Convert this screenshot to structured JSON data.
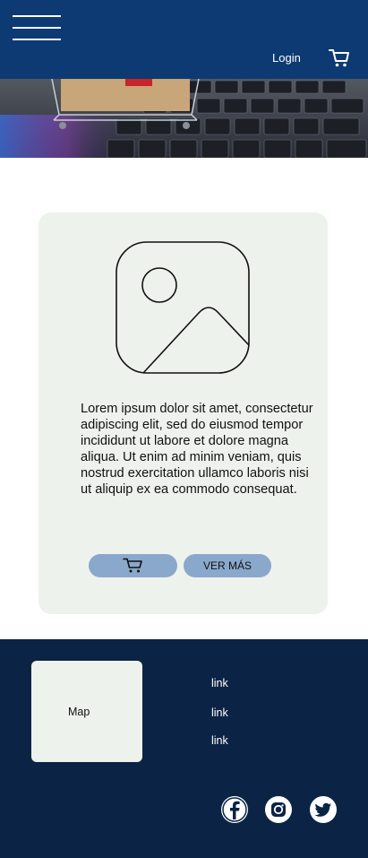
{
  "header": {
    "login_label": "Login",
    "menu_icon": "hamburger-menu-icon",
    "cart_icon": "shopping-cart-icon",
    "background_color": "#0d3a73"
  },
  "hero": {
    "image": "shopping-cart-on-laptop-keyboard-photo"
  },
  "card": {
    "image_icon": "image-placeholder-icon",
    "description": "Lorem ipsum dolor sit amet, consectetur adipiscing elit, sed do eiusmod tempor incididunt ut labore et dolore magna aliqua. Ut enim ad minim veniam, quis nostrud exercitation ullamco laboris nisi ut aliquip ex ea commodo consequat.",
    "cart_button_icon": "shopping-cart-icon",
    "more_button_label": "VER MÁS",
    "background_color": "#eef2ed",
    "button_color": "#8aa8cc"
  },
  "footer": {
    "map_label": "Map",
    "links": [
      "link",
      "link",
      "link"
    ],
    "social_icons": [
      "facebook-icon",
      "instagram-icon",
      "twitter-icon"
    ],
    "background_color": "#0b2445"
  }
}
